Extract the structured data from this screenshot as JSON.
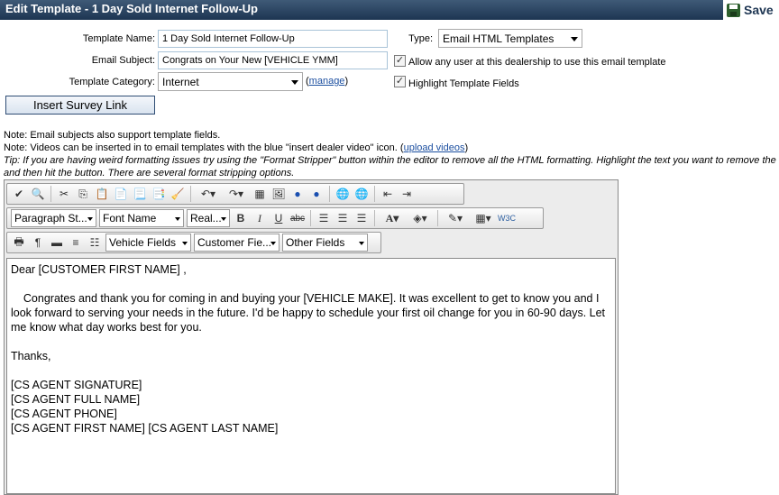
{
  "window": {
    "title": "Edit Template - 1 Day Sold Internet Follow-Up",
    "save_label": "Save"
  },
  "form": {
    "template_name_label": "Template Name:",
    "template_name_value": "1 Day Sold Internet Follow-Up",
    "email_subject_label": "Email Subject:",
    "email_subject_value": "Congrats on Your New [VEHICLE YMM]",
    "category_label": "Template Category:",
    "category_value": "Internet",
    "manage_open": "(",
    "manage_link": "manage",
    "manage_close": ")",
    "type_label": "Type:",
    "type_value": "Email HTML Templates",
    "allow_label": "Allow any user at this dealership to use this email template",
    "allow_checked": "✓",
    "highlight_label": "Highlight Template Fields",
    "highlight_checked": "✓"
  },
  "survey_button_label": "Insert Survey Link",
  "notes": {
    "note1": "Note: Email subjects also support template fields.",
    "note2_prefix": "Note: Videos can be inserted in to email templates with the blue \"insert dealer video\" icon. (",
    "note2_link": "upload videos",
    "note2_suffix": ")",
    "tip_line1": "Tip: If you are having weird formatting issues try using the \"Format Stripper\" button within the editor to remove all the HTML formatting. Highlight the text you want to remove the",
    "tip_line2": "and then hit the button. There are several format stripping options."
  },
  "toolbar": {
    "paragraph_style": "Paragraph St...",
    "font_name": "Font Name",
    "font_size": "Real...",
    "vehicle_fields": "Vehicle Fields",
    "customer_fields": "Customer Fie...",
    "other_fields": "Other Fields"
  },
  "body": {
    "greeting": "Dear [CUSTOMER FIRST NAME] ,",
    "paragraph": "    Congrates and thank you for coming in and buying your [VEHICLE MAKE]. It was excellent to get to know you and I look forward to serving your needs in the future. I'd be happy to schedule your first oil change for you in 60-90 days. Let me know what day works best for you.",
    "closing": "Thanks,",
    "sig1": "[CS AGENT SIGNATURE]",
    "sig2": "[CS AGENT FULL NAME]",
    "sig3": "[CS AGENT PHONE]",
    "sig4": "[CS AGENT FIRST NAME] [CS AGENT LAST NAME]"
  }
}
